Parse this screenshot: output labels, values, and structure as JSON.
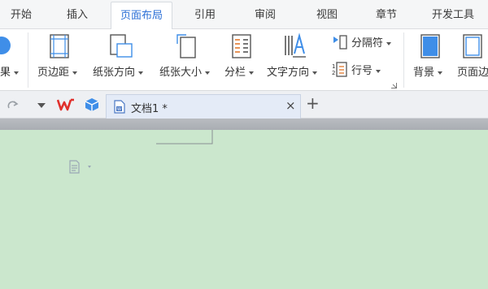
{
  "menu_tabs": [
    {
      "label": "开始"
    },
    {
      "label": "插入"
    },
    {
      "label": "页面布局",
      "active": true
    },
    {
      "label": "引用"
    },
    {
      "label": "审阅"
    },
    {
      "label": "视图"
    },
    {
      "label": "章节"
    },
    {
      "label": "开发工具"
    }
  ],
  "ribbon": {
    "partial_left_label": "果",
    "margins_label": "页边距",
    "orientation_label": "纸张方向",
    "size_label": "纸张大小",
    "columns_label": "分栏",
    "text_direction_label": "文字方向",
    "breaks_label": "分隔符",
    "line_numbers_label": "行号",
    "background_label": "背景",
    "page_border_label": "页面边"
  },
  "tabstrip": {
    "doc_tab_title": "文档1 *",
    "close_glyph": "×",
    "new_tab_glyph": "+"
  },
  "colors": {
    "active_tab_text": "#2b6fd6",
    "page_background": "#cbe7cd",
    "wps_red": "#e0302c",
    "cube_blue": "#3f8ee8"
  }
}
